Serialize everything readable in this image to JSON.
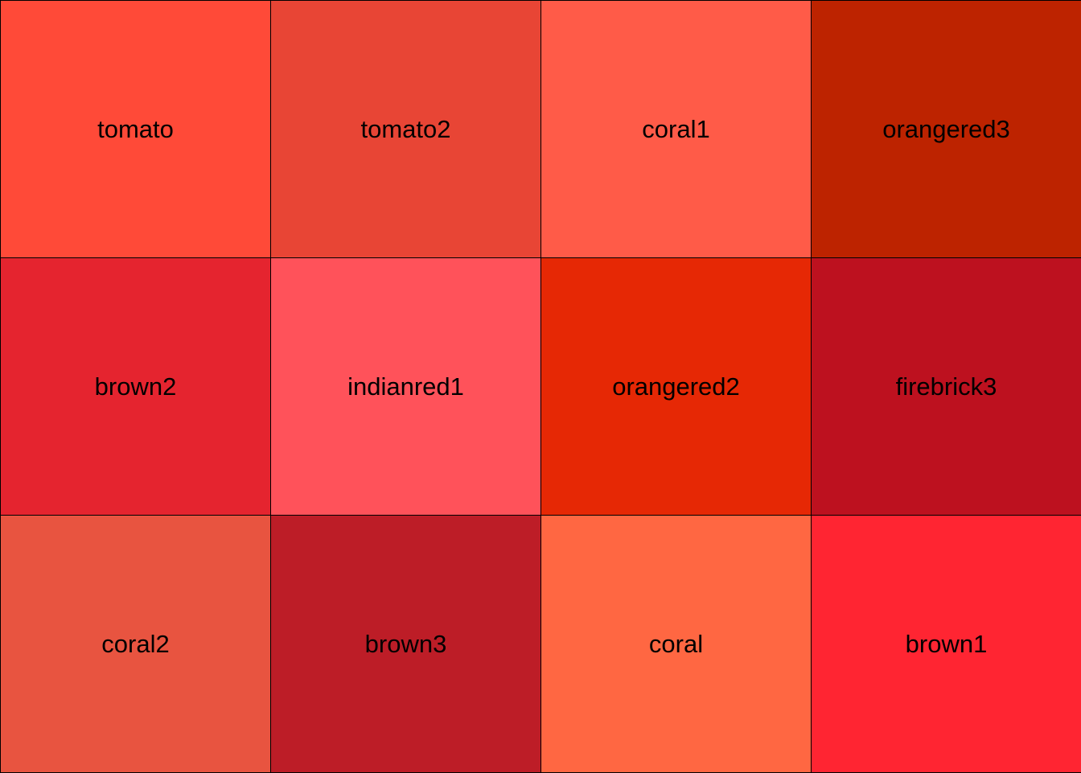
{
  "chart_data": {
    "type": "table",
    "columns": 4,
    "rows": 3,
    "cells": [
      {
        "label": "tomato",
        "color": "#ff4a38"
      },
      {
        "label": "tomato2",
        "color": "#e84535"
      },
      {
        "label": "coral1",
        "color": "#ff5b48"
      },
      {
        "label": "orangered3",
        "color": "#bd2300"
      },
      {
        "label": "brown2",
        "color": "#e5242f"
      },
      {
        "label": "indianred1",
        "color": "#ff525a"
      },
      {
        "label": "orangered2",
        "color": "#e62805"
      },
      {
        "label": "firebrick3",
        "color": "#bd111f"
      },
      {
        "label": "coral2",
        "color": "#e85440"
      },
      {
        "label": "brown3",
        "color": "#bd1d27"
      },
      {
        "label": "coral",
        "color": "#ff6742"
      },
      {
        "label": "brown1",
        "color": "#ff2532"
      }
    ]
  }
}
